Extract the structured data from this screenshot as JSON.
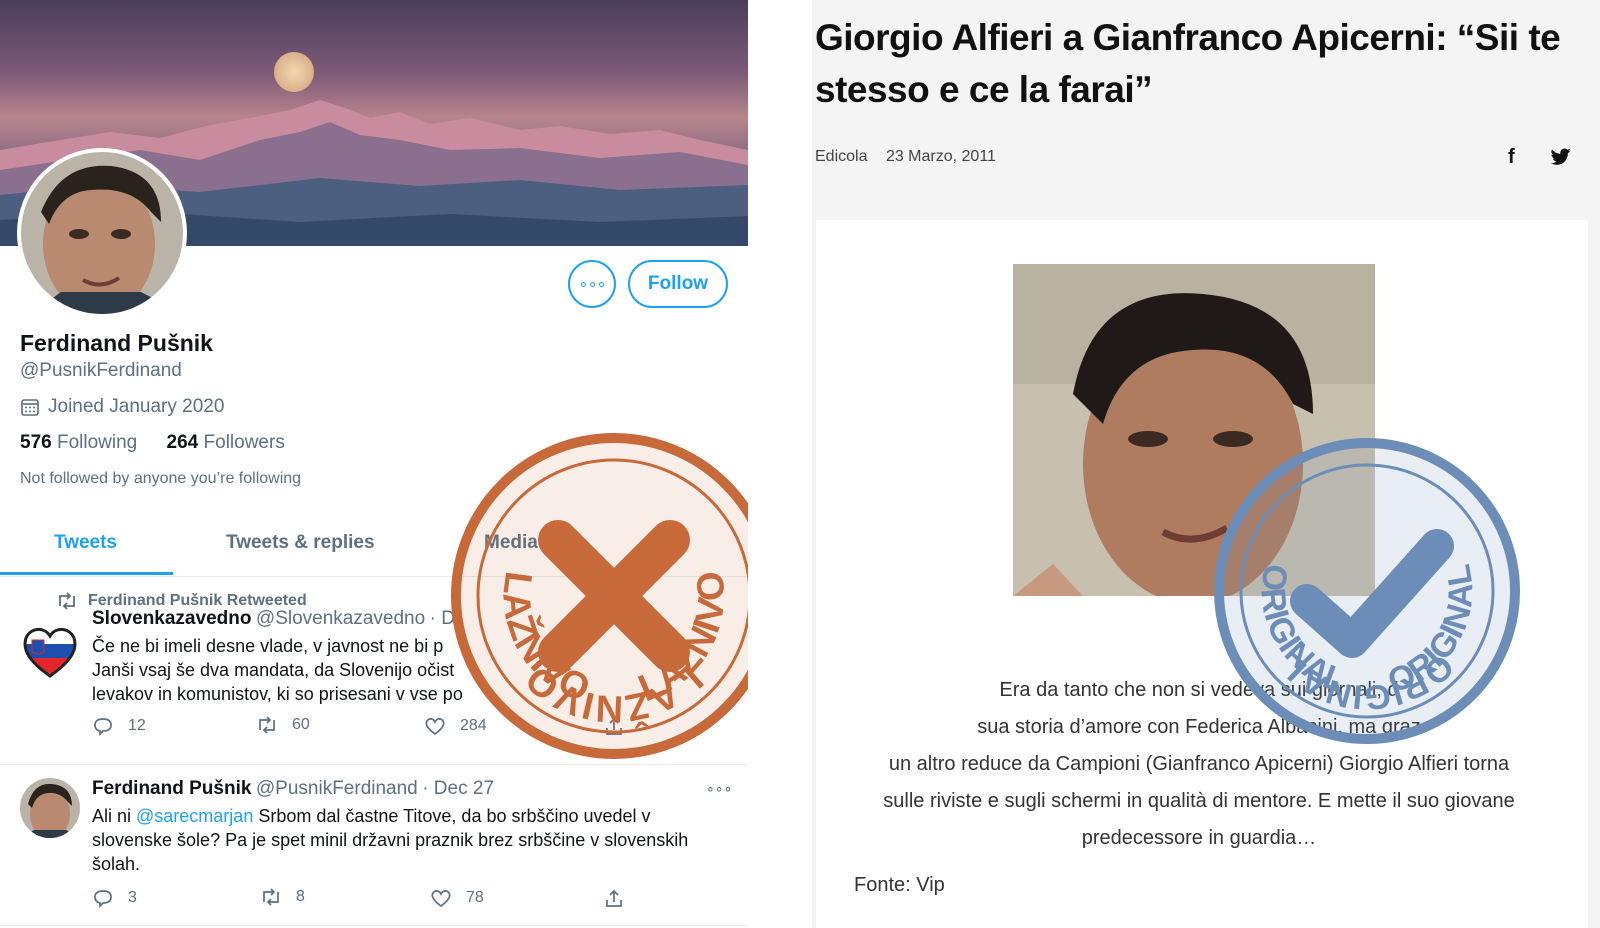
{
  "profile": {
    "name": "Ferdinand Pušnik",
    "handle": "@PusnikFerdinand",
    "joined": "Joined January 2020",
    "following_count": "576",
    "following_label": "Following",
    "followers_count": "264",
    "followers_label": "Followers",
    "not_followed": "Not followed by anyone you’re following",
    "follow_label": "Follow",
    "more_label": "∘∘∘"
  },
  "tabs": [
    "Tweets",
    "Tweets & replies",
    "Media",
    "Likes"
  ],
  "tabs_visible": {
    "t0": "Tweets",
    "t1": "Tweets & replies",
    "t2": "Media",
    "t3": "es"
  },
  "tweets": [
    {
      "retweet_label": "Ferdinand Pušnik Retweeted",
      "author": "Slovenkazavedno",
      "handle": "@Slovenkazavedno",
      "date": "· D",
      "lines": [
        "Če ne bi imeli desne vlade, v javnost ne bi p",
        "Janši vsaj še dva mandata, da Slovenijo očist",
        "levakov in komunistov, ki so prisesani v vse po"
      ],
      "replies": "12",
      "retweets": "60",
      "likes": "284"
    },
    {
      "author": "Ferdinand Pušnik",
      "handle": "@PusnikFerdinand",
      "date": "· Dec 27",
      "line1_prefix": "Ali ni ",
      "mention": "@sarecmarjan",
      "line1_suffix": " Srbom dal častne Titove, da bo srbščino uvedel v",
      "line2": "slovenske šole? Pa je spet minil državni praznik brez srbščine v slovenskih",
      "line3": "šolah.",
      "replies": "3",
      "retweets": "8",
      "likes": "78",
      "more": "∘∘∘"
    }
  ],
  "stamp_fake": {
    "text": "LAŽNIVO",
    "color": "#c8693a"
  },
  "stamp_real": {
    "text": "ORIGINAL",
    "color": "#6b8db8"
  },
  "article": {
    "headline_l1": "Giorgio Alfieri a Gianfranco Apicerni: “Sii te",
    "headline_l2": "stesso e ce la farai”",
    "section": "Edicola",
    "date": "23 Marzo, 2011",
    "share_fb": "f",
    "body_l1": "Era da tanto che non si vedeva sui giornali, d",
    "body_l2": "sua storia d’amore con Federica Albasini, ma graz",
    "body_l3": "un altro reduce da Campioni (Gianfranco Apicerni) Giorgio Alfieri torna",
    "body_l4": "sulle riviste e sugli schermi in qualità di mentore. E mette il suo giovane",
    "body_l5": "predecessore in guardia…",
    "source": "Fonte: Vip"
  }
}
